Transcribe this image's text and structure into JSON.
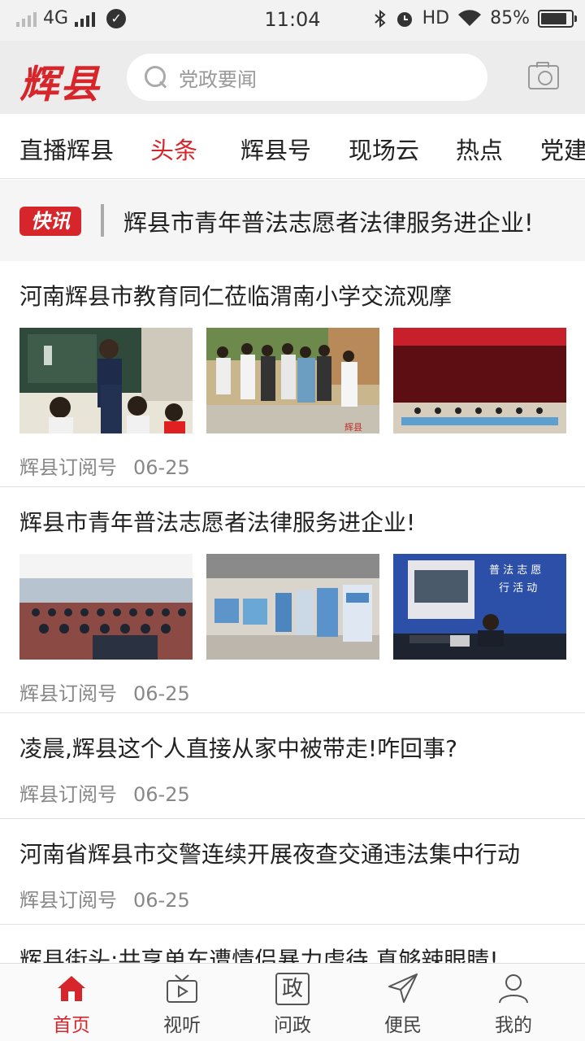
{
  "status_bar": {
    "network": "4G",
    "time": "11:04",
    "hd": "HD",
    "battery": "85%",
    "battery_level": 0.85
  },
  "header": {
    "logo": "辉县",
    "search_placeholder": "党政要闻"
  },
  "tabs": [
    {
      "label": "直播辉县",
      "active": false
    },
    {
      "label": "头条",
      "active": true
    },
    {
      "label": "辉县号",
      "active": false
    },
    {
      "label": "现场云",
      "active": false
    },
    {
      "label": "热点",
      "active": false
    },
    {
      "label": "党建",
      "active": false
    }
  ],
  "flash": {
    "badge": "快讯",
    "text": "辉县市青年普法志愿者法律服务进企业!"
  },
  "news": [
    {
      "title": "河南辉县市教育同仁莅临渭南小学交流观摩",
      "source": "辉县订阅号",
      "date": "06-25"
    },
    {
      "title": "辉县市青年普法志愿者法律服务进企业!",
      "source": "辉县订阅号",
      "date": "06-25"
    },
    {
      "title": "凌晨,辉县这个人直接从家中被带走!咋回事?",
      "source": "辉县订阅号",
      "date": "06-25"
    },
    {
      "title": "河南省辉县市交警连续开展夜查交通违法集中行动",
      "source": "辉县订阅号",
      "date": "06-25"
    },
    {
      "title": "辉县街头:共享单车遭情侣暴力虐待,真够辣眼睛!"
    }
  ],
  "bottom_nav": [
    {
      "label": "首页",
      "icon": "home-icon",
      "active": true
    },
    {
      "label": "视听",
      "icon": "tv-icon",
      "active": false
    },
    {
      "label": "问政",
      "icon": "zheng-icon",
      "glyph": "政",
      "active": false
    },
    {
      "label": "便民",
      "icon": "paper-plane-icon",
      "active": false
    },
    {
      "label": "我的",
      "icon": "user-icon",
      "active": false
    }
  ],
  "colors": {
    "accent": "#d7262b"
  }
}
